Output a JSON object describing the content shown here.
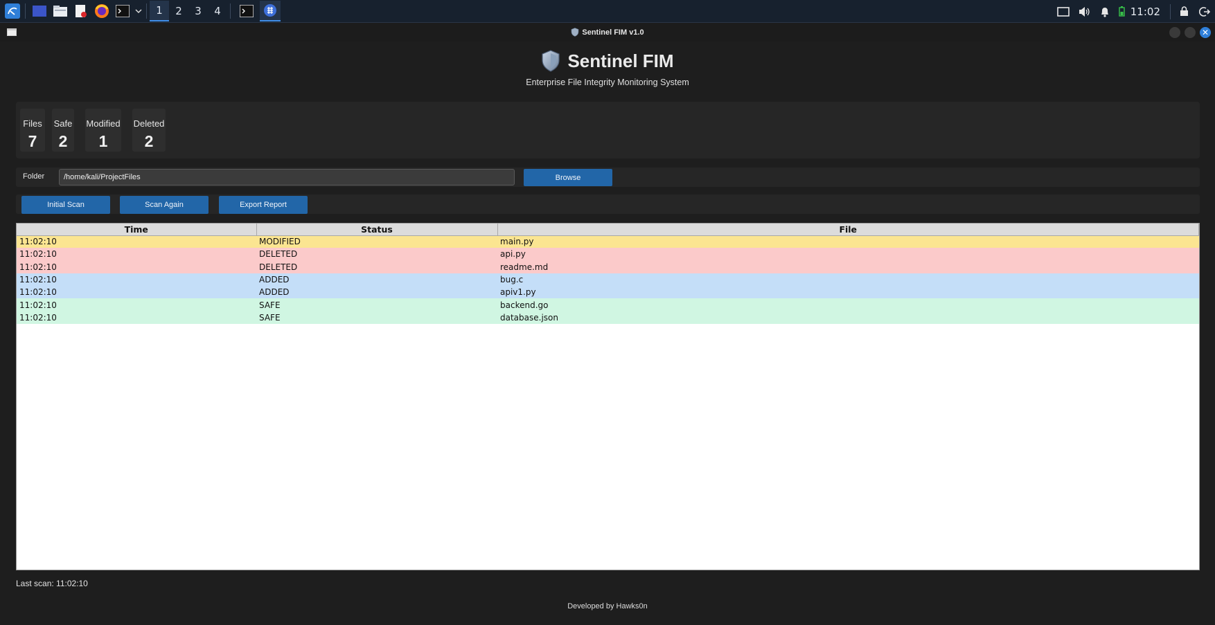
{
  "taskbar": {
    "workspaces": [
      "1",
      "2",
      "3",
      "4"
    ],
    "active_workspace": "1",
    "clock": "11:02"
  },
  "window": {
    "title": "Sentinel FIM v1.0"
  },
  "header": {
    "title": "Sentinel FIM",
    "subtitle": "Enterprise File Integrity Monitoring System"
  },
  "stats": {
    "files": {
      "label": "Files",
      "value": "7"
    },
    "safe": {
      "label": "Safe",
      "value": "2"
    },
    "modified": {
      "label": "Modified",
      "value": "1"
    },
    "deleted": {
      "label": "Deleted",
      "value": "2"
    }
  },
  "folder": {
    "label": "Folder",
    "path": "/home/kali/ProjectFiles",
    "browse_label": "Browse"
  },
  "actions": {
    "initial_scan": "Initial Scan",
    "scan_again": "Scan Again",
    "export_report": "Export Report"
  },
  "table": {
    "columns": [
      "Time",
      "Status",
      "File"
    ],
    "rows": [
      {
        "time": "11:02:10",
        "status": "MODIFIED",
        "file": "main.py"
      },
      {
        "time": "11:02:10",
        "status": "DELETED",
        "file": "api.py"
      },
      {
        "time": "11:02:10",
        "status": "DELETED",
        "file": "readme.md"
      },
      {
        "time": "11:02:10",
        "status": "ADDED",
        "file": "bug.c"
      },
      {
        "time": "11:02:10",
        "status": "ADDED",
        "file": "apiv1.py"
      },
      {
        "time": "11:02:10",
        "status": "SAFE",
        "file": "backend.go"
      },
      {
        "time": "11:02:10",
        "status": "SAFE",
        "file": "database.json"
      }
    ]
  },
  "footer": {
    "last_scan": "Last scan: 11:02:10",
    "developed_by": "Developed by Hawks0n"
  },
  "colors": {
    "modified_row": "#fbe591",
    "deleted_row": "#fbcaca",
    "added_row": "#c4def8",
    "safe_row": "#d0f6e2",
    "button": "#2266a8",
    "background": "#1e1e1e"
  }
}
